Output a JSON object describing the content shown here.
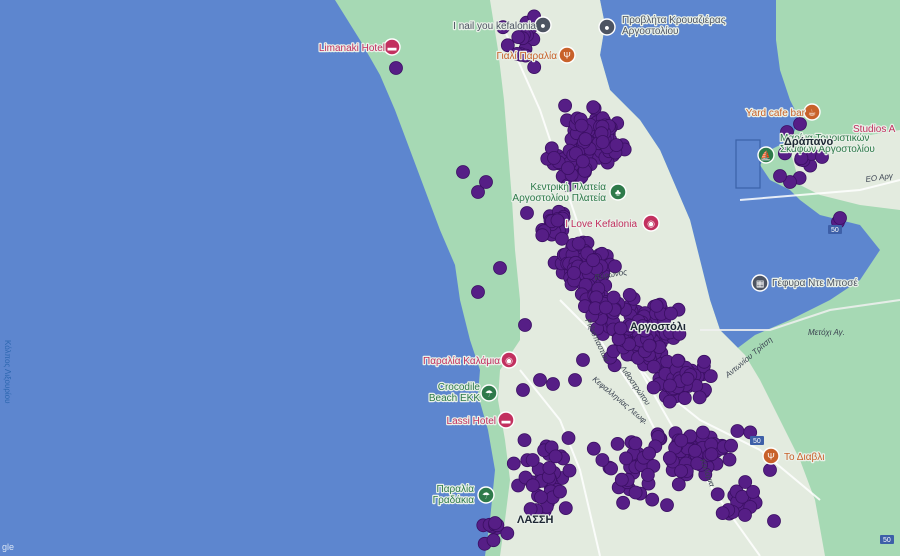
{
  "colors": {
    "water": "#5d86cf",
    "land_green": "#a6d9b4",
    "land_urban": "#e3ebdf",
    "dot_fill": "#561e86",
    "poi_pink": "#c2305f",
    "poi_green": "#2e7a4a",
    "poi_grey": "#4d5462",
    "poi_orange": "#c8612a"
  },
  "pois": [
    {
      "id": "nail",
      "label": "I nail you kefalonia",
      "category": "grey",
      "icon": "pin-icon"
    },
    {
      "id": "ferry",
      "label": "Προβλήτα Κρουαζιέρας Αργοστολίου",
      "category": "grey",
      "icon": "pin-icon",
      "lines": [
        "Προβλήτα Κρουαζιέρας",
        "Αργοστολίου"
      ]
    },
    {
      "id": "limanaki",
      "label": "Limanaki Hotel",
      "category": "pink",
      "icon": "bed-icon"
    },
    {
      "id": "gialiparalia",
      "label": "Γιαλί Παραλία",
      "category": "orange",
      "icon": "fork-knife-icon"
    },
    {
      "id": "yardcafe",
      "label": "Yard cafe bar",
      "category": "orange",
      "icon": "cafe-icon"
    },
    {
      "id": "studios",
      "label": "Studios A",
      "category": "pink",
      "icon": "bed-icon"
    },
    {
      "id": "marina",
      "label": "Μαρίνα Τουριστικών Σκαφών Αργοστολίου",
      "category": "green",
      "icon": "boat-icon",
      "lines": [
        "Μαρίνα Τουριστικών",
        "Σκαφών Αργοστολίου"
      ]
    },
    {
      "id": "kentriki",
      "label": "Κεντρική Πλατεία Αργοστολίου Πλατεία",
      "category": "green",
      "icon": "tree-icon",
      "lines": [
        "Κεντρική Πλατεία",
        "Αργοστολίου Πλατεία"
      ]
    },
    {
      "id": "lovekef",
      "label": "I Love Kefalonia",
      "category": "pink",
      "icon": "camera-icon"
    },
    {
      "id": "gefyra",
      "label": "Γέφυρα Ντε Μποσέ",
      "category": "grey",
      "icon": "landmark-icon"
    },
    {
      "id": "kalamia",
      "label": "Παραλία Καλάμια",
      "category": "pink",
      "icon": "camera-icon"
    },
    {
      "id": "crocodile",
      "label": "Crocodile Beach EKK",
      "category": "green",
      "icon": "beach-icon",
      "lines": [
        "Crocodile",
        "Beach EKK"
      ]
    },
    {
      "id": "lassi",
      "label": "Lassi Hotel",
      "category": "pink",
      "icon": "bed-icon"
    },
    {
      "id": "diavli",
      "label": "Το Διαβλι",
      "category": "orange",
      "icon": "fork-knife-icon"
    },
    {
      "id": "gradakia",
      "label": "Παραλία Γραδάκια",
      "category": "green",
      "icon": "beach-icon",
      "lines": [
        "Παραλία",
        "Γραδάκια"
      ]
    }
  ],
  "places": [
    {
      "id": "argostoli",
      "label": "Αργοστόλι"
    },
    {
      "id": "drapano",
      "label": "Δράπανο"
    },
    {
      "id": "lassi_area",
      "label": "ΛΑΣΣΗ"
    }
  ],
  "streets": [
    {
      "id": "vyronos",
      "label": "Βύρωνος"
    },
    {
      "id": "rizospaston",
      "label": "Ριζοσπαστών"
    },
    {
      "id": "kefallinias",
      "label": "Κεφαλληνίας Λεωφ."
    },
    {
      "id": "antoni",
      "label": "Αντωνίου Τρίτση"
    },
    {
      "id": "lithostrotou",
      "label": "Λιθοστρώτου"
    },
    {
      "id": "metochi",
      "label": "Μετόχι Αγ."
    },
    {
      "id": "eo_arg",
      "label": "ΕΟ Αργ"
    },
    {
      "id": "kalamia_road",
      "label": "Καλάμια"
    }
  ],
  "road_shields": [
    "50",
    "50",
    "50"
  ],
  "water_labels": [
    {
      "id": "kolpos",
      "label": "Κόλπος Λιξουρίου"
    }
  ],
  "attribution": "gle"
}
